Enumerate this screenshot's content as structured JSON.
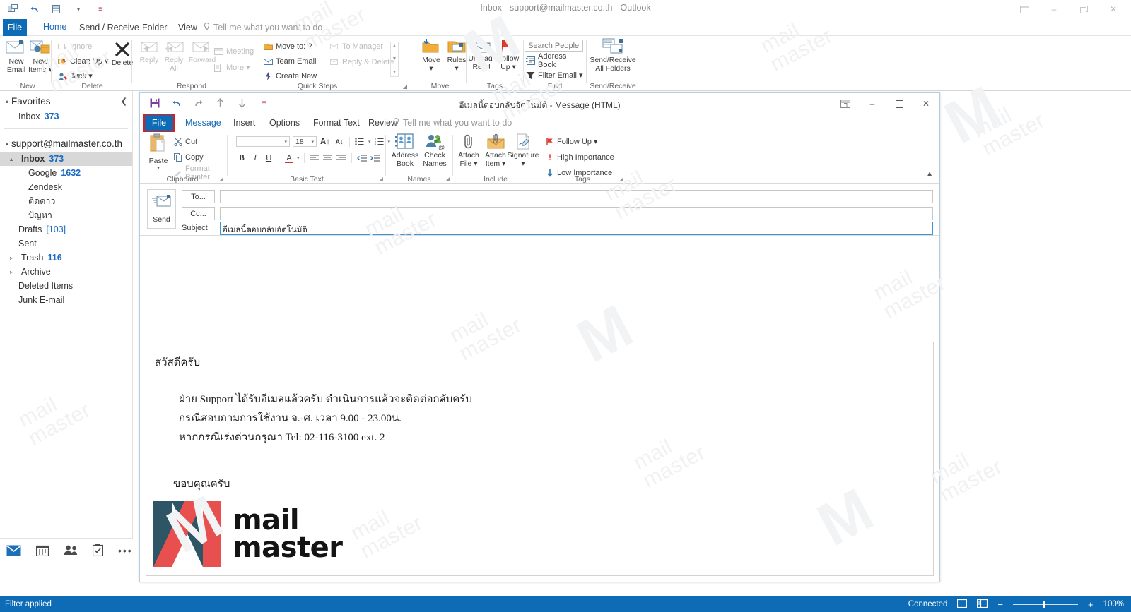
{
  "main_window": {
    "title": "Inbox - support@mailmaster.co.th  -  Outlook",
    "quick_access": [
      {
        "name": "send-receive-qat-icon",
        "glyph": "✉"
      },
      {
        "name": "undo-qat-icon",
        "glyph": "↶"
      },
      {
        "name": "touch-mode-qat-icon",
        "glyph": "☰"
      },
      {
        "name": "qat-dropdown-icon",
        "glyph": "▾"
      },
      {
        "name": "customize-qat-icon",
        "glyph": "≡"
      }
    ],
    "window_controls": [
      {
        "name": "ribbon-display-options-icon",
        "glyph": "⬜"
      },
      {
        "name": "minimize-icon",
        "glyph": "–"
      },
      {
        "name": "restore-icon",
        "glyph": "❐"
      },
      {
        "name": "close-icon",
        "glyph": "✕"
      }
    ],
    "tabs": [
      {
        "label": "File",
        "key": "file"
      },
      {
        "label": "Home",
        "key": "home"
      },
      {
        "label": "Send / Receive",
        "key": "sendreceive"
      },
      {
        "label": "Folder",
        "key": "folder"
      },
      {
        "label": "View",
        "key": "view"
      }
    ],
    "tell_me": "Tell me what you want to do"
  },
  "ribbon": {
    "groups": [
      {
        "name": "New",
        "label": "New",
        "buttons": [
          {
            "label": "New\nEmail",
            "label_l1": "New",
            "label_l2": "Email",
            "name": "new-email-button"
          },
          {
            "label": "New Items",
            "label_l1": "New",
            "label_l2": "Items ▾",
            "name": "new-items-button"
          }
        ]
      },
      {
        "name": "Delete",
        "label": "Delete",
        "small": [
          {
            "label": "Ignore",
            "name": "ignore-button",
            "disabled": true
          },
          {
            "label": "Clean Up ▾",
            "name": "clean-up-button",
            "disabled": false
          },
          {
            "label": "Junk ▾",
            "name": "junk-button",
            "disabled": false
          }
        ],
        "big": [
          {
            "label": "Delete",
            "name": "delete-button"
          }
        ]
      },
      {
        "name": "Respond",
        "label": "Respond",
        "big": [
          {
            "label": "Reply",
            "name": "reply-button"
          },
          {
            "label": "Reply All",
            "label_l1": "Reply",
            "label_l2": "All",
            "name": "reply-all-button"
          },
          {
            "label": "Forward",
            "name": "forward-button"
          }
        ],
        "small": [
          {
            "label": "Meeting",
            "name": "meeting-button"
          },
          {
            "label": "More ▾",
            "name": "more-respond-button"
          }
        ]
      },
      {
        "name": "Quick Steps",
        "label": "Quick Steps",
        "small": [
          {
            "label": "Move to: ?",
            "name": "move-to-quickstep"
          },
          {
            "label": "Team Email",
            "name": "team-email-quickstep"
          },
          {
            "label": "Create New",
            "name": "create-new-quickstep"
          },
          {
            "label": "To Manager",
            "name": "to-manager-quickstep",
            "disabled": true
          },
          {
            "label": "Reply & Delete",
            "name": "reply-and-delete-quickstep",
            "disabled": true
          }
        ]
      },
      {
        "name": "Move",
        "label": "Move",
        "big": [
          {
            "label": "Move ▾",
            "label_l1": "Move",
            "label_l2": "▾",
            "name": "move-button"
          },
          {
            "label": "Rules ▾",
            "label_l1": "Rules",
            "label_l2": "▾",
            "name": "rules-button"
          }
        ]
      },
      {
        "name": "Tags",
        "label": "Tags",
        "big": [
          {
            "label": "Unread/ Read",
            "label_l1": "Unread/",
            "label_l2": "Read",
            "name": "unread-read-button"
          },
          {
            "label": "Follow Up ▾",
            "label_l1": "Follow",
            "label_l2": "Up ▾",
            "name": "follow-up-button"
          }
        ]
      },
      {
        "name": "Find",
        "label": "Find",
        "search_placeholder": "Search People",
        "small": [
          {
            "label": "Address Book",
            "name": "address-book-button"
          },
          {
            "label": "Filter Email ▾",
            "name": "filter-email-button"
          }
        ]
      },
      {
        "name": "Send/Receive",
        "label": "Send/Receive",
        "big": [
          {
            "label": "Send/Receive All Folders",
            "label_l1": "Send/Receive",
            "label_l2": "All Folders",
            "name": "send-receive-all-folders-button"
          }
        ]
      }
    ]
  },
  "folder_pane": {
    "favorites_header": "Favorites",
    "favorites": [
      {
        "label": "Inbox",
        "count": "373"
      }
    ],
    "account": "support@mailmaster.co.th",
    "folders": [
      {
        "label": "Inbox",
        "count": "373",
        "selected": true,
        "indent": 1,
        "expander": "▴"
      },
      {
        "label": "Google",
        "count": "1632",
        "indent": 2
      },
      {
        "label": "Zendesk",
        "count": "",
        "indent": 2
      },
      {
        "label": "ติดดาว",
        "count": "",
        "indent": 2
      },
      {
        "label": "ปัญหา",
        "count": "",
        "indent": 2
      },
      {
        "label": "Drafts",
        "count": "[103]",
        "indent": 1
      },
      {
        "label": "Sent",
        "count": "",
        "indent": 1
      },
      {
        "label": "Trash",
        "count": "116",
        "indent": 1,
        "expander": "▹"
      },
      {
        "label": "Archive",
        "count": "",
        "indent": 1,
        "expander": "▹"
      },
      {
        "label": "Deleted Items",
        "count": "",
        "indent": 1
      },
      {
        "label": "Junk E-mail",
        "count": "",
        "indent": 1
      }
    ],
    "nav_buttons": [
      {
        "name": "mail-nav-icon",
        "glyph": "✉",
        "active": true
      },
      {
        "name": "calendar-nav-icon",
        "glyph": "▦",
        "active": false
      },
      {
        "name": "people-nav-icon",
        "glyph": "●",
        "active": false
      },
      {
        "name": "tasks-nav-icon",
        "glyph": "☑",
        "active": false
      },
      {
        "name": "more-nav-icon",
        "glyph": "•••",
        "active": false
      }
    ]
  },
  "status_bar": {
    "left_text": "Filter applied",
    "connection": "Connected",
    "zoom": "100%",
    "view_icons": [
      {
        "name": "normal-view-icon",
        "glyph": "▭"
      },
      {
        "name": "reading-view-icon",
        "glyph": "▤"
      }
    ]
  },
  "compose_window": {
    "title": "อีเมลนี้ตอบกลับอัตโนมัติ  -  Message (HTML)",
    "quick_access": [
      {
        "name": "save-qat-icon",
        "glyph": "💾"
      },
      {
        "name": "undo-qat-icon",
        "glyph": "↶"
      },
      {
        "name": "redo-qat-icon",
        "glyph": "↷"
      },
      {
        "name": "previous-item-qat-icon",
        "glyph": "↑"
      },
      {
        "name": "next-item-qat-icon",
        "glyph": "↓"
      },
      {
        "name": "customize-qat-icon",
        "glyph": "≡"
      }
    ],
    "window_controls": [
      {
        "name": "ribbon-display-options-icon",
        "glyph": "⬜"
      },
      {
        "name": "minimize-icon",
        "glyph": "–"
      },
      {
        "name": "maximize-icon",
        "glyph": "❐"
      },
      {
        "name": "close-icon",
        "glyph": "✕"
      }
    ],
    "tabs": [
      {
        "label": "File",
        "key": "file"
      },
      {
        "label": "Message",
        "key": "message"
      },
      {
        "label": "Insert",
        "key": "insert"
      },
      {
        "label": "Options",
        "key": "options"
      },
      {
        "label": "Format Text",
        "key": "formattext"
      },
      {
        "label": "Review",
        "key": "review"
      }
    ],
    "tell_me": "Tell me what you want to do",
    "ribbon_groups": [
      {
        "label": "Clipboard",
        "paste_label": "Paste",
        "items": [
          {
            "label": "Cut",
            "name": "cut-button"
          },
          {
            "label": "Copy",
            "name": "copy-button"
          },
          {
            "label": "Format Painter",
            "name": "format-painter-button"
          }
        ]
      },
      {
        "label": "Basic Text",
        "font_name": "",
        "font_size": "18",
        "buttons": [
          {
            "label": "B",
            "name": "bold-button"
          },
          {
            "label": "I",
            "name": "italic-button"
          },
          {
            "label": "U",
            "name": "underline-button"
          },
          {
            "label": "A",
            "name": "font-color-button"
          }
        ]
      },
      {
        "label": "Names",
        "big": [
          {
            "label_l1": "Address",
            "label_l2": "Book",
            "name": "address-book-button"
          },
          {
            "label_l1": "Check",
            "label_l2": "Names",
            "name": "check-names-button"
          }
        ]
      },
      {
        "label": "Include",
        "big": [
          {
            "label_l1": "Attach",
            "label_l2": "File ▾",
            "name": "attach-file-button"
          },
          {
            "label_l1": "Attach",
            "label_l2": "Item ▾",
            "name": "attach-item-button"
          },
          {
            "label_l1": "Signature",
            "label_l2": "▾",
            "name": "signature-button"
          }
        ]
      },
      {
        "label": "Tags",
        "small": [
          {
            "label": "Follow Up ▾",
            "name": "follow-up-button"
          },
          {
            "label": "High Importance",
            "name": "high-importance-button"
          },
          {
            "label": "Low Importance",
            "name": "low-importance-button"
          }
        ]
      }
    ],
    "header": {
      "send_label": "Send",
      "to_label": "To...",
      "cc_label": "Cc...",
      "subject_label": "Subject",
      "to_value": "",
      "cc_value": "",
      "subject_value": "อีเมลนี้ตอบกลับอัตโนมัติ"
    },
    "body": {
      "greeting": "สวัสดีครับ",
      "line1": "ฝ่าย Support ได้รับอีเมลแล้วครับ ดำเนินการแล้วจะติดต่อกลับครับ",
      "line2": "กรณีสอบถามการใช้งาน จ.-ศ. เวลา 9.00 - 23.00น.",
      "line3": "หากกรณีเร่งด่วนกรุณา Tel: 02-116-3100 ext. 2",
      "closing": "ขอบคุณครับ",
      "logo_line1": "mail",
      "logo_line2": "master"
    }
  },
  "colors": {
    "accent_blue": "#0d6cb5",
    "file_tab_blue": "#0d6cb5",
    "highlight_red": "#e01b1b",
    "count_blue": "#1769c0",
    "logo_teal": "#2d5566",
    "logo_red": "#e8504f"
  },
  "watermark": {
    "line1": "mail",
    "line2": "master"
  }
}
